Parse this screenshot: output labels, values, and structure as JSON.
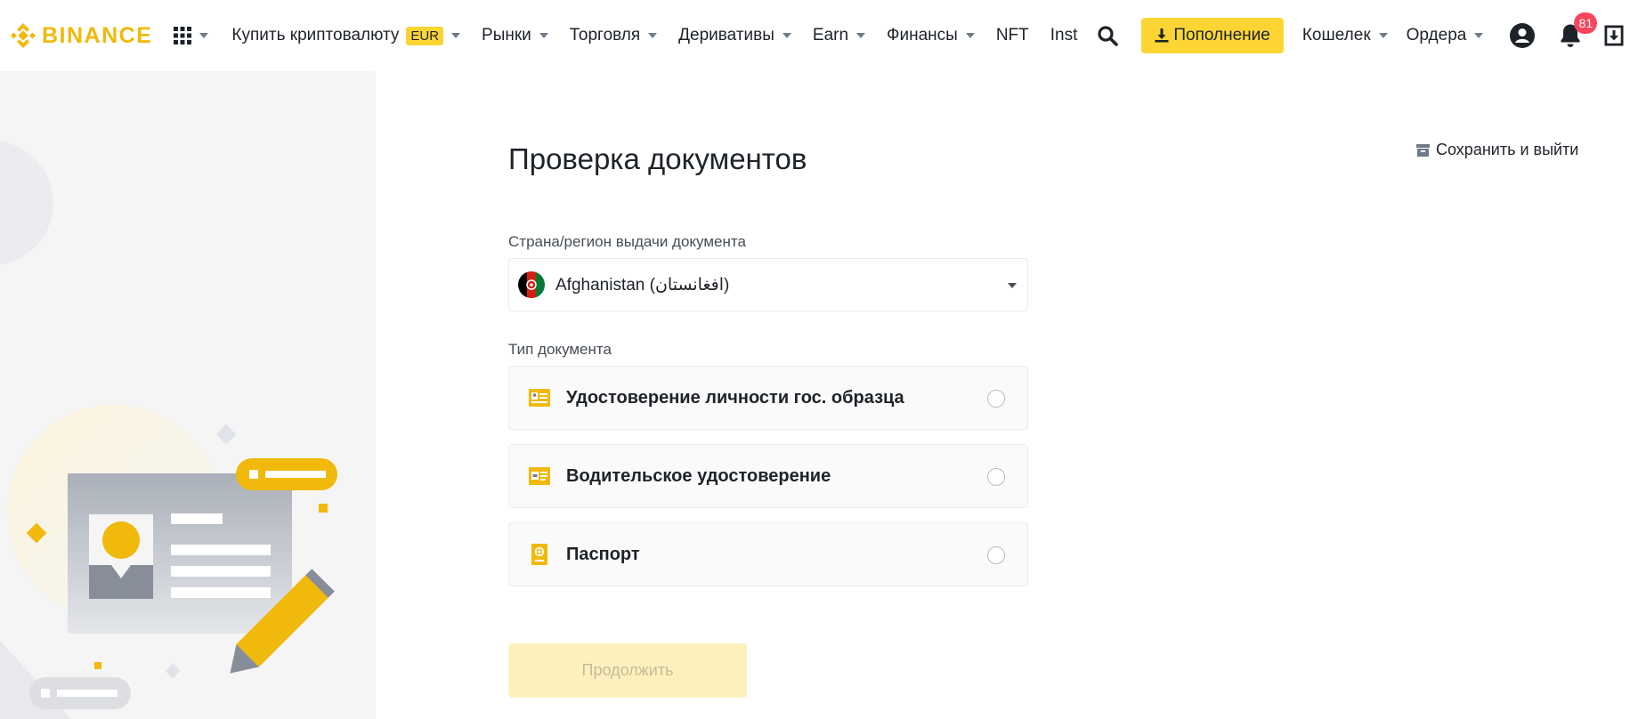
{
  "header": {
    "logo_text": "BINANCE",
    "nav": [
      {
        "label": "Купить криптовалюту",
        "badge": "EUR",
        "has_caret": true
      },
      {
        "label": "Рынки",
        "has_caret": true
      },
      {
        "label": "Торговля",
        "has_caret": true
      },
      {
        "label": "Деривативы",
        "has_caret": true
      },
      {
        "label": "Earn",
        "has_caret": true
      },
      {
        "label": "Финансы",
        "has_caret": true
      },
      {
        "label": "NFT",
        "has_caret": false
      },
      {
        "label": "Inst",
        "has_caret": false
      }
    ],
    "deposit_label": "Пополнение",
    "wallet_label": "Кошелек",
    "orders_label": "Ордера",
    "notification_count": "81"
  },
  "main": {
    "title": "Проверка документов",
    "save_exit_label": "Сохранить и выйти",
    "country_label": "Страна/регион выдачи документа",
    "country_value": "Afghanistan (افغانستان)",
    "doc_type_label": "Тип документа",
    "doc_options": [
      {
        "label": "Удостоверение личности гос. образца",
        "icon": "id-card-icon",
        "selected": false
      },
      {
        "label": "Водительское удостоверение",
        "icon": "driver-license-icon",
        "selected": false
      },
      {
        "label": "Паспорт",
        "icon": "passport-icon",
        "selected": false
      }
    ],
    "continue_label": "Продолжить",
    "continue_enabled": false
  },
  "colors": {
    "brand": "#f0b90b",
    "primary_button": "#fcd535",
    "disabled_button": "#fcf0bd",
    "notification": "#f6465d",
    "text": "#1e2329"
  }
}
